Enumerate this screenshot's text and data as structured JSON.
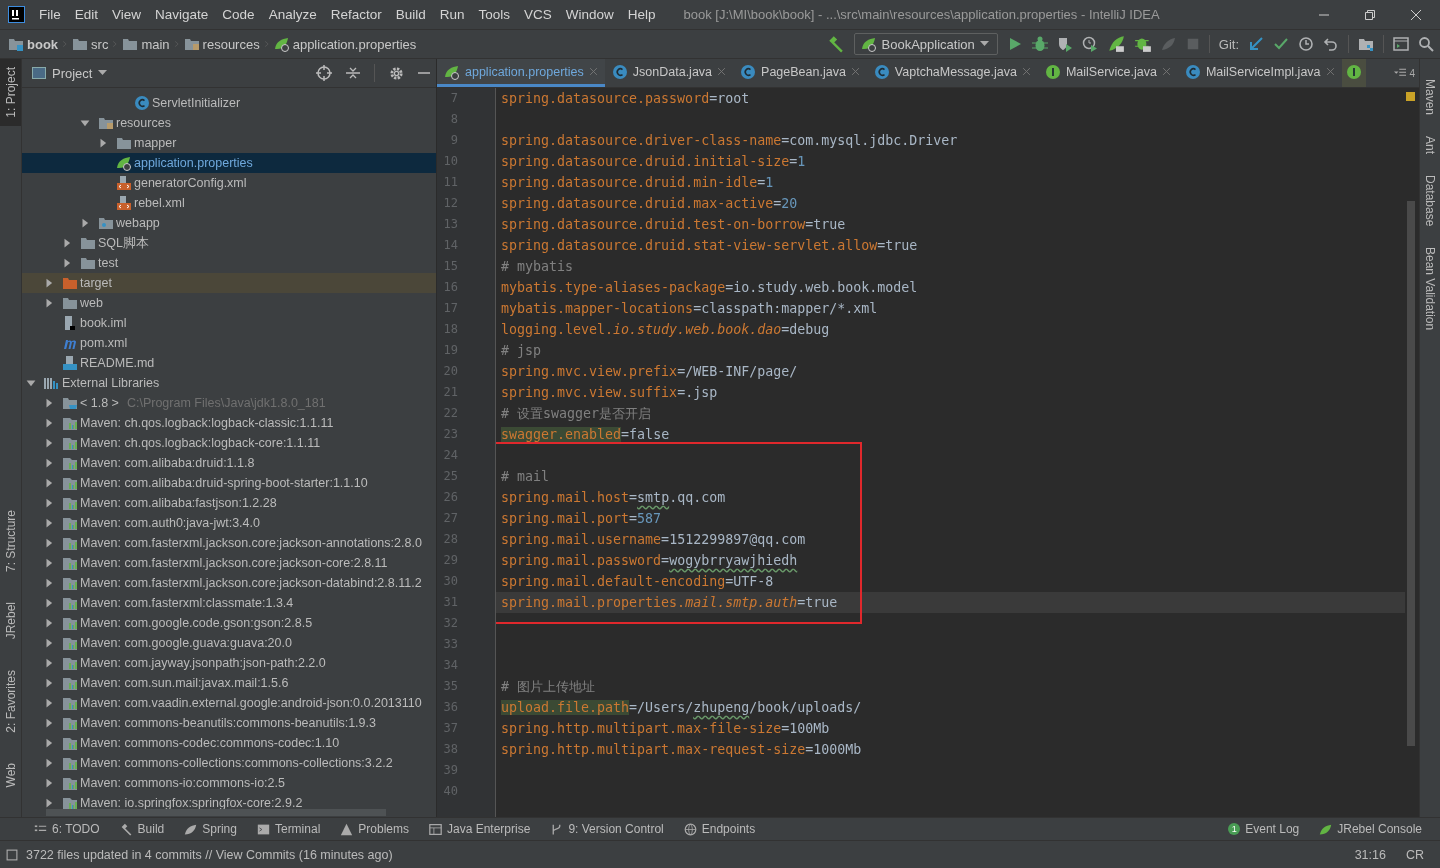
{
  "window": {
    "title": "book [J:\\MI\\book\\book] - ...\\src\\main\\resources\\application.properties - IntelliJ IDEA"
  },
  "menu": [
    "File",
    "Edit",
    "View",
    "Navigate",
    "Code",
    "Analyze",
    "Refactor",
    "Build",
    "Run",
    "Tools",
    "VCS",
    "Window",
    "Help"
  ],
  "breadcrumbs": [
    {
      "label": "book",
      "kind": "module"
    },
    {
      "label": "src",
      "kind": "folder"
    },
    {
      "label": "main",
      "kind": "folder"
    },
    {
      "label": "resources",
      "kind": "resources"
    },
    {
      "label": "application.properties",
      "kind": "spring"
    }
  ],
  "toolbar": {
    "run_config": "BookApplication",
    "vcs_label": "Git:"
  },
  "left_tool_tabs_top": [
    {
      "label": "1: Project",
      "selected": true
    }
  ],
  "left_tool_tabs_bottom": [
    {
      "label": "7: Structure",
      "selected": false
    },
    {
      "label": "JRebel",
      "selected": false
    },
    {
      "label": "2: Favorites",
      "selected": false
    },
    {
      "label": "Web",
      "selected": false
    }
  ],
  "right_tool_tabs": [
    {
      "label": "Maven"
    },
    {
      "label": "Ant"
    },
    {
      "label": "Database"
    },
    {
      "label": "Bean Validation"
    }
  ],
  "project_panel": {
    "title": "Project",
    "tree": [
      {
        "children": [
          {
            "children": [
              {
                "children": [
                  {
                    "children": [
                      {
                        "children": [
                          {
                            "label": "ServletInitializer",
                            "kind": "class",
                            "selected": false
                          }
                        ]
                      }
                    ]
                  },
                  {
                    "label": "resources",
                    "kind": "resources",
                    "expanded": true,
                    "selected": false,
                    "children": [
                      {
                        "label": "mapper",
                        "kind": "folder",
                        "expanded": false,
                        "selected": false
                      },
                      {
                        "label": "application.properties",
                        "kind": "spring",
                        "selected": true
                      },
                      {
                        "label": "generatorConfig.xml",
                        "kind": "xml",
                        "selected": false
                      },
                      {
                        "label": "rebel.xml",
                        "kind": "xml",
                        "selected": false
                      }
                    ]
                  },
                  {
                    "label": "webapp",
                    "kind": "webapp",
                    "expanded": false,
                    "selected": false
                  }
                ]
              },
              {
                "label": "SQL脚本",
                "kind": "folder",
                "expanded": false,
                "selected": false
              },
              {
                "label": "test",
                "kind": "folder",
                "expanded": false,
                "selected": false
              }
            ]
          },
          {
            "label": "target",
            "kind": "excluded",
            "expanded": false,
            "selected": false
          },
          {
            "label": "web",
            "kind": "folder",
            "expanded": false,
            "selected": false
          },
          {
            "label": "book.iml",
            "kind": "iml",
            "selected": false
          },
          {
            "label": "pom.xml",
            "kind": "maven",
            "selected": false
          },
          {
            "label": "README.md",
            "kind": "md",
            "selected": false
          }
        ]
      },
      {
        "label": "External Libraries",
        "kind": "libraries",
        "expanded": true,
        "selected": false,
        "children": [
          {
            "label": "< 1.8 >",
            "detail": "C:\\Program Files\\Java\\jdk1.8.0_181",
            "kind": "jdk",
            "expanded": false,
            "selected": false
          },
          {
            "label": "Maven: ch.qos.logback:logback-classic:1.1.11",
            "kind": "library",
            "expanded": false,
            "selected": false
          },
          {
            "label": "Maven: ch.qos.logback:logback-core:1.1.11",
            "kind": "library",
            "expanded": false,
            "selected": false
          },
          {
            "label": "Maven: com.alibaba:druid:1.1.8",
            "kind": "library",
            "expanded": false,
            "selected": false
          },
          {
            "label": "Maven: com.alibaba:druid-spring-boot-starter:1.1.10",
            "kind": "library",
            "expanded": false,
            "selected": false
          },
          {
            "label": "Maven: com.alibaba:fastjson:1.2.28",
            "kind": "library",
            "expanded": false,
            "selected": false
          },
          {
            "label": "Maven: com.auth0:java-jwt:3.4.0",
            "kind": "library",
            "expanded": false,
            "selected": false
          },
          {
            "label": "Maven: com.fasterxml.jackson.core:jackson-annotations:2.8.0",
            "kind": "library",
            "expanded": false,
            "selected": false
          },
          {
            "label": "Maven: com.fasterxml.jackson.core:jackson-core:2.8.11",
            "kind": "library",
            "expanded": false,
            "selected": false
          },
          {
            "label": "Maven: com.fasterxml.jackson.core:jackson-databind:2.8.11.2",
            "kind": "library",
            "expanded": false,
            "selected": false
          },
          {
            "label": "Maven: com.fasterxml:classmate:1.3.4",
            "kind": "library",
            "expanded": false,
            "selected": false
          },
          {
            "label": "Maven: com.google.code.gson:gson:2.8.5",
            "kind": "library",
            "expanded": false,
            "selected": false
          },
          {
            "label": "Maven: com.google.guava:guava:20.0",
            "kind": "library",
            "expanded": false,
            "selected": false
          },
          {
            "label": "Maven: com.jayway.jsonpath:json-path:2.2.0",
            "kind": "library",
            "expanded": false,
            "selected": false
          },
          {
            "label": "Maven: com.sun.mail:javax.mail:1.5.6",
            "kind": "library",
            "expanded": false,
            "selected": false
          },
          {
            "label": "Maven: com.vaadin.external.google:android-json:0.0.2013110",
            "kind": "library",
            "expanded": false,
            "selected": false
          },
          {
            "label": "Maven: commons-beanutils:commons-beanutils:1.9.3",
            "kind": "library",
            "expanded": false,
            "selected": false
          },
          {
            "label": "Maven: commons-codec:commons-codec:1.10",
            "kind": "library",
            "expanded": false,
            "selected": false
          },
          {
            "label": "Maven: commons-collections:commons-collections:3.2.2",
            "kind": "library",
            "expanded": false,
            "selected": false
          },
          {
            "label": "Maven: commons-io:commons-io:2.5",
            "kind": "library",
            "expanded": false,
            "selected": false
          },
          {
            "label": "Maven: io.springfox:springfox-core:2.9.2",
            "kind": "library",
            "expanded": false,
            "selected": false
          }
        ]
      }
    ]
  },
  "editor_tabs": [
    {
      "label": "application.properties",
      "kind": "spring",
      "selected": true
    },
    {
      "label": "JsonData.java",
      "kind": "class",
      "selected": false
    },
    {
      "label": "PageBean.java",
      "kind": "class",
      "selected": false
    },
    {
      "label": "VaptchaMessage.java",
      "kind": "class",
      "selected": false
    },
    {
      "label": "MailService.java",
      "kind": "interface",
      "selected": false
    },
    {
      "label": "MailServiceImpl.java",
      "kind": "class",
      "selected": false
    },
    {
      "kind": "interface",
      "selected": false
    }
  ],
  "hidden_tabs_count": "4",
  "code_lines": [
    {
      "number": "7",
      "current": false,
      "segments": [
        {
          "text": "spring.datasource.password",
          "kind": "key"
        },
        {
          "text": "=",
          "kind": "op"
        },
        {
          "text": "root",
          "kind": "value"
        }
      ]
    },
    {
      "number": "8",
      "current": false
    },
    {
      "number": "9",
      "current": false,
      "segments": [
        {
          "text": "spring.datasource.driver-class-name",
          "kind": "key"
        },
        {
          "text": "=",
          "kind": "op"
        },
        {
          "text": "com.mysql.jdbc.Driver",
          "kind": "value"
        }
      ]
    },
    {
      "number": "10",
      "current": false,
      "segments": [
        {
          "text": "spring.datasource.druid.initial-size",
          "kind": "key"
        },
        {
          "text": "=",
          "kind": "op"
        },
        {
          "text": "1",
          "kind": "number"
        }
      ]
    },
    {
      "number": "11",
      "current": false,
      "segments": [
        {
          "text": "spring.datasource.druid.min-idle",
          "kind": "key"
        },
        {
          "text": "=",
          "kind": "op"
        },
        {
          "text": "1",
          "kind": "number"
        }
      ]
    },
    {
      "number": "12",
      "current": false,
      "segments": [
        {
          "text": "spring.datasource.druid.max-active",
          "kind": "key"
        },
        {
          "text": "=",
          "kind": "op"
        },
        {
          "text": "20",
          "kind": "number"
        }
      ]
    },
    {
      "number": "13",
      "current": false,
      "segments": [
        {
          "text": "spring.datasource.druid.test-on-borrow",
          "kind": "key"
        },
        {
          "text": "=",
          "kind": "op"
        },
        {
          "text": "true",
          "kind": "value"
        }
      ]
    },
    {
      "number": "14",
      "current": false,
      "segments": [
        {
          "text": "spring.datasource.druid.stat-view-servlet.allow",
          "kind": "key"
        },
        {
          "text": "=",
          "kind": "op"
        },
        {
          "text": "true",
          "kind": "value"
        }
      ]
    },
    {
      "number": "15",
      "current": false,
      "segments": [
        {
          "text": "# mybatis",
          "kind": "comment"
        }
      ]
    },
    {
      "number": "16",
      "current": false,
      "segments": [
        {
          "text": "mybatis.type-aliases-package",
          "kind": "key"
        },
        {
          "text": "=",
          "kind": "op"
        },
        {
          "text": "io.study.web.book.model",
          "kind": "value"
        }
      ]
    },
    {
      "number": "17",
      "current": false,
      "segments": [
        {
          "text": "mybatis.mapper-locations",
          "kind": "key"
        },
        {
          "text": "=",
          "kind": "op"
        },
        {
          "text": "classpath:mapper/*.xml",
          "kind": "value"
        }
      ]
    },
    {
      "number": "18",
      "current": false,
      "segments": [
        {
          "text": "logging.level.",
          "kind": "key"
        },
        {
          "text": "io.study.web.book.dao",
          "kind": "key",
          "italic": true
        },
        {
          "text": "=",
          "kind": "op"
        },
        {
          "text": "debug",
          "kind": "plain"
        }
      ]
    },
    {
      "number": "19",
      "current": false,
      "segments": [
        {
          "text": "# jsp",
          "kind": "comment"
        }
      ]
    },
    {
      "number": "20",
      "current": false,
      "segments": [
        {
          "text": "spring.mvc.view.prefix",
          "kind": "key"
        },
        {
          "text": "=",
          "kind": "op"
        },
        {
          "text": "/WEB-INF/page/",
          "kind": "value"
        }
      ]
    },
    {
      "number": "21",
      "current": false,
      "segments": [
        {
          "text": "spring.mvc.view.suffix",
          "kind": "key"
        },
        {
          "text": "=",
          "kind": "op"
        },
        {
          "text": ".jsp",
          "kind": "value"
        }
      ]
    },
    {
      "number": "22",
      "current": false,
      "segments": [
        {
          "text": "# 设置swagger是否开启",
          "kind": "comment"
        }
      ]
    },
    {
      "number": "23",
      "current": false,
      "segments": [
        {
          "text": "swagger.enabled",
          "kind": "key",
          "highlight": true
        },
        {
          "text": "=",
          "kind": "op"
        },
        {
          "text": "false",
          "kind": "value"
        }
      ]
    },
    {
      "number": "24",
      "current": false
    },
    {
      "number": "25",
      "current": false,
      "segments": [
        {
          "text": "# mail",
          "kind": "comment"
        }
      ]
    },
    {
      "number": "26",
      "current": false,
      "segments": [
        {
          "text": "spring.mail.host",
          "kind": "key"
        },
        {
          "text": "=",
          "kind": "op"
        },
        {
          "text": "smtp",
          "kind": "value",
          "typo": true
        },
        {
          "text": ".qq.com",
          "kind": "value"
        }
      ]
    },
    {
      "number": "27",
      "current": false,
      "segments": [
        {
          "text": "spring.mail.port",
          "kind": "key"
        },
        {
          "text": "=",
          "kind": "op"
        },
        {
          "text": "587",
          "kind": "number"
        }
      ]
    },
    {
      "number": "28",
      "current": false,
      "segments": [
        {
          "text": "spring.mail.username",
          "kind": "key"
        },
        {
          "text": "=",
          "kind": "op"
        },
        {
          "text": "1512299897@qq.com",
          "kind": "value"
        }
      ]
    },
    {
      "number": "29",
      "current": false,
      "segments": [
        {
          "text": "spring.mail.password",
          "kind": "key"
        },
        {
          "text": "=",
          "kind": "op"
        },
        {
          "text": "wogybrryawjhiedh",
          "kind": "value",
          "typo": true
        }
      ]
    },
    {
      "number": "30",
      "current": false,
      "segments": [
        {
          "text": "spring.mail.default-encoding",
          "kind": "key"
        },
        {
          "text": "=",
          "kind": "op"
        },
        {
          "text": "UTF-8",
          "kind": "value"
        }
      ]
    },
    {
      "number": "31",
      "current": true,
      "segments": [
        {
          "text": "spring.mail.properties.",
          "kind": "key"
        },
        {
          "text": "mail.smtp.auth",
          "kind": "key",
          "italic": true
        },
        {
          "text": "=",
          "kind": "op"
        },
        {
          "text": "true",
          "kind": "value"
        }
      ]
    },
    {
      "number": "32",
      "current": false
    },
    {
      "number": "33",
      "current": false
    },
    {
      "number": "34",
      "current": false
    },
    {
      "number": "35",
      "current": false,
      "segments": [
        {
          "text": "# 图片上传地址",
          "kind": "comment"
        }
      ]
    },
    {
      "number": "36",
      "current": false,
      "segments": [
        {
          "text": "upload.file.path",
          "kind": "key",
          "highlight": true
        },
        {
          "text": "=",
          "kind": "op"
        },
        {
          "text": "/Users/",
          "kind": "value"
        },
        {
          "text": "zhupeng",
          "kind": "value",
          "typo": true
        },
        {
          "text": "/book/uploads/",
          "kind": "value"
        }
      ]
    },
    {
      "number": "37",
      "current": false,
      "segments": [
        {
          "text": "spring.http.multipart.max-file-size",
          "kind": "key"
        },
        {
          "text": "=",
          "kind": "op"
        },
        {
          "text": "100Mb",
          "kind": "value"
        }
      ]
    },
    {
      "number": "38",
      "current": false,
      "segments": [
        {
          "text": "spring.http.multipart.max-request-size",
          "kind": "key"
        },
        {
          "text": "=",
          "kind": "op"
        },
        {
          "text": "1000Mb",
          "kind": "value"
        }
      ]
    },
    {
      "number": "39",
      "current": false
    },
    {
      "number": "40",
      "current": false
    }
  ],
  "bottom_tools_left": [
    {
      "label": "6: TODO",
      "kind": "list"
    },
    {
      "label": "Build",
      "kind": "hammer"
    },
    {
      "label": "Spring",
      "kind": "leaf"
    },
    {
      "label": "Terminal",
      "kind": "terminal"
    },
    {
      "label": "Problems",
      "kind": "warning"
    },
    {
      "label": "Java Enterprise",
      "kind": "grid"
    },
    {
      "label": "9: Version Control",
      "kind": "branch"
    },
    {
      "label": "Endpoints",
      "kind": "globe"
    }
  ],
  "bottom_tools_right": [
    {
      "label": "Event Log",
      "kind": "badge",
      "badge": "1"
    },
    {
      "label": "JRebel Console",
      "kind": "rebel"
    }
  ],
  "status_bar": {
    "message": "3722 files updated in 4 commits // View Commits (16 minutes ago)",
    "position": "31:16",
    "line_separator": "CR"
  }
}
